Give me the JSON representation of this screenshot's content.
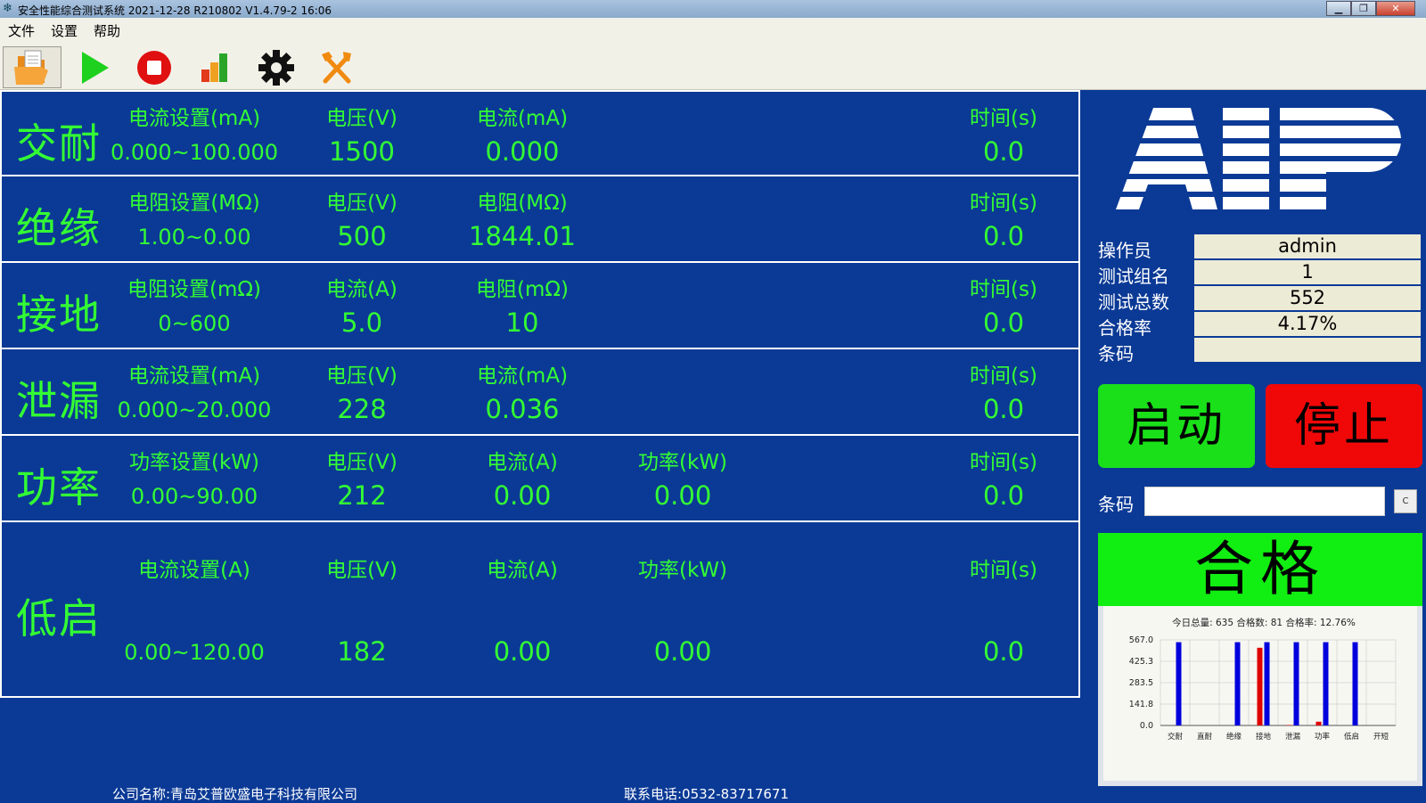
{
  "window": {
    "title": "安全性能综合测试系统 2021-12-28 R210802 V1.4.79-2 16:06",
    "minimize": "▁",
    "restore": "❐",
    "close": "✕"
  },
  "menu": [
    "文件",
    "设置",
    "帮助"
  ],
  "toolbar": {
    "icons": [
      "open-folder-icon",
      "play-icon",
      "stop-icon",
      "bar-chart-icon",
      "gear-icon",
      "tools-icon"
    ]
  },
  "tests": [
    {
      "name": "交耐",
      "headers": [
        "电流设置(mA)",
        "电压(V)",
        "电流(mA)",
        "",
        "时间(s)"
      ],
      "values": [
        "0.000~100.000",
        "1500",
        "0.000",
        "",
        "0.0"
      ]
    },
    {
      "name": "绝缘",
      "headers": [
        "电阻设置(MΩ)",
        "电压(V)",
        "电阻(MΩ)",
        "",
        "时间(s)"
      ],
      "values": [
        "1.00~0.00",
        "500",
        "1844.01",
        "",
        "0.0"
      ]
    },
    {
      "name": "接地",
      "headers": [
        "电阻设置(mΩ)",
        "电流(A)",
        "电阻(mΩ)",
        "",
        "时间(s)"
      ],
      "values": [
        "0~600",
        "5.0",
        "10",
        "",
        "0.0"
      ]
    },
    {
      "name": "泄漏",
      "headers": [
        "电流设置(mA)",
        "电压(V)",
        "电流(mA)",
        "",
        "时间(s)"
      ],
      "values": [
        "0.000~20.000",
        "228",
        "0.036",
        "",
        "0.0"
      ]
    },
    {
      "name": "功率",
      "headers": [
        "功率设置(kW)",
        "电压(V)",
        "电流(A)",
        "功率(kW)",
        "时间(s)"
      ],
      "values": [
        "0.00~90.00",
        "212",
        "0.00",
        "0.00",
        "0.0"
      ]
    },
    {
      "name": "低启",
      "headers": [
        "电流设置(A)",
        "电压(V)",
        "电流(A)",
        "功率(kW)",
        "时间(s)"
      ],
      "values": [
        "0.00~120.00",
        "182",
        "0.00",
        "0.00",
        "0.0"
      ]
    }
  ],
  "logo": "AIP",
  "info": [
    {
      "label": "操作员",
      "value": "admin"
    },
    {
      "label": "测试组名",
      "value": "1"
    },
    {
      "label": "测试总数",
      "value": "552"
    },
    {
      "label": "合格率",
      "value": "4.17%"
    },
    {
      "label": "条码",
      "value": ""
    }
  ],
  "buttons": {
    "start": "启动",
    "stop": "停止"
  },
  "barcode": {
    "label": "条码",
    "value": "",
    "clear": "C"
  },
  "result": "合格",
  "chart_data": {
    "type": "bar",
    "title": "今日总量: 635  合格数: 81  合格率: 12.76%",
    "categories": [
      "交耐",
      "直耐",
      "绝缘",
      "接地",
      "泄漏",
      "功率",
      "低启",
      "开短"
    ],
    "y_ticks": [
      "567.0",
      "425.3",
      "283.5",
      "141.8",
      "0.0"
    ],
    "ylim": [
      0,
      567
    ],
    "series": [
      {
        "color": "#e00000",
        "values": [
          0,
          0,
          0,
          515,
          3,
          25,
          0,
          0
        ]
      },
      {
        "color": "#0000dd",
        "values": [
          552,
          0,
          552,
          552,
          552,
          552,
          552,
          0
        ]
      }
    ],
    "grid": true
  },
  "footer": {
    "company": "公司名称:青岛艾普欧盛电子科技有限公司",
    "phone": "联系电话:0532-83717671"
  }
}
